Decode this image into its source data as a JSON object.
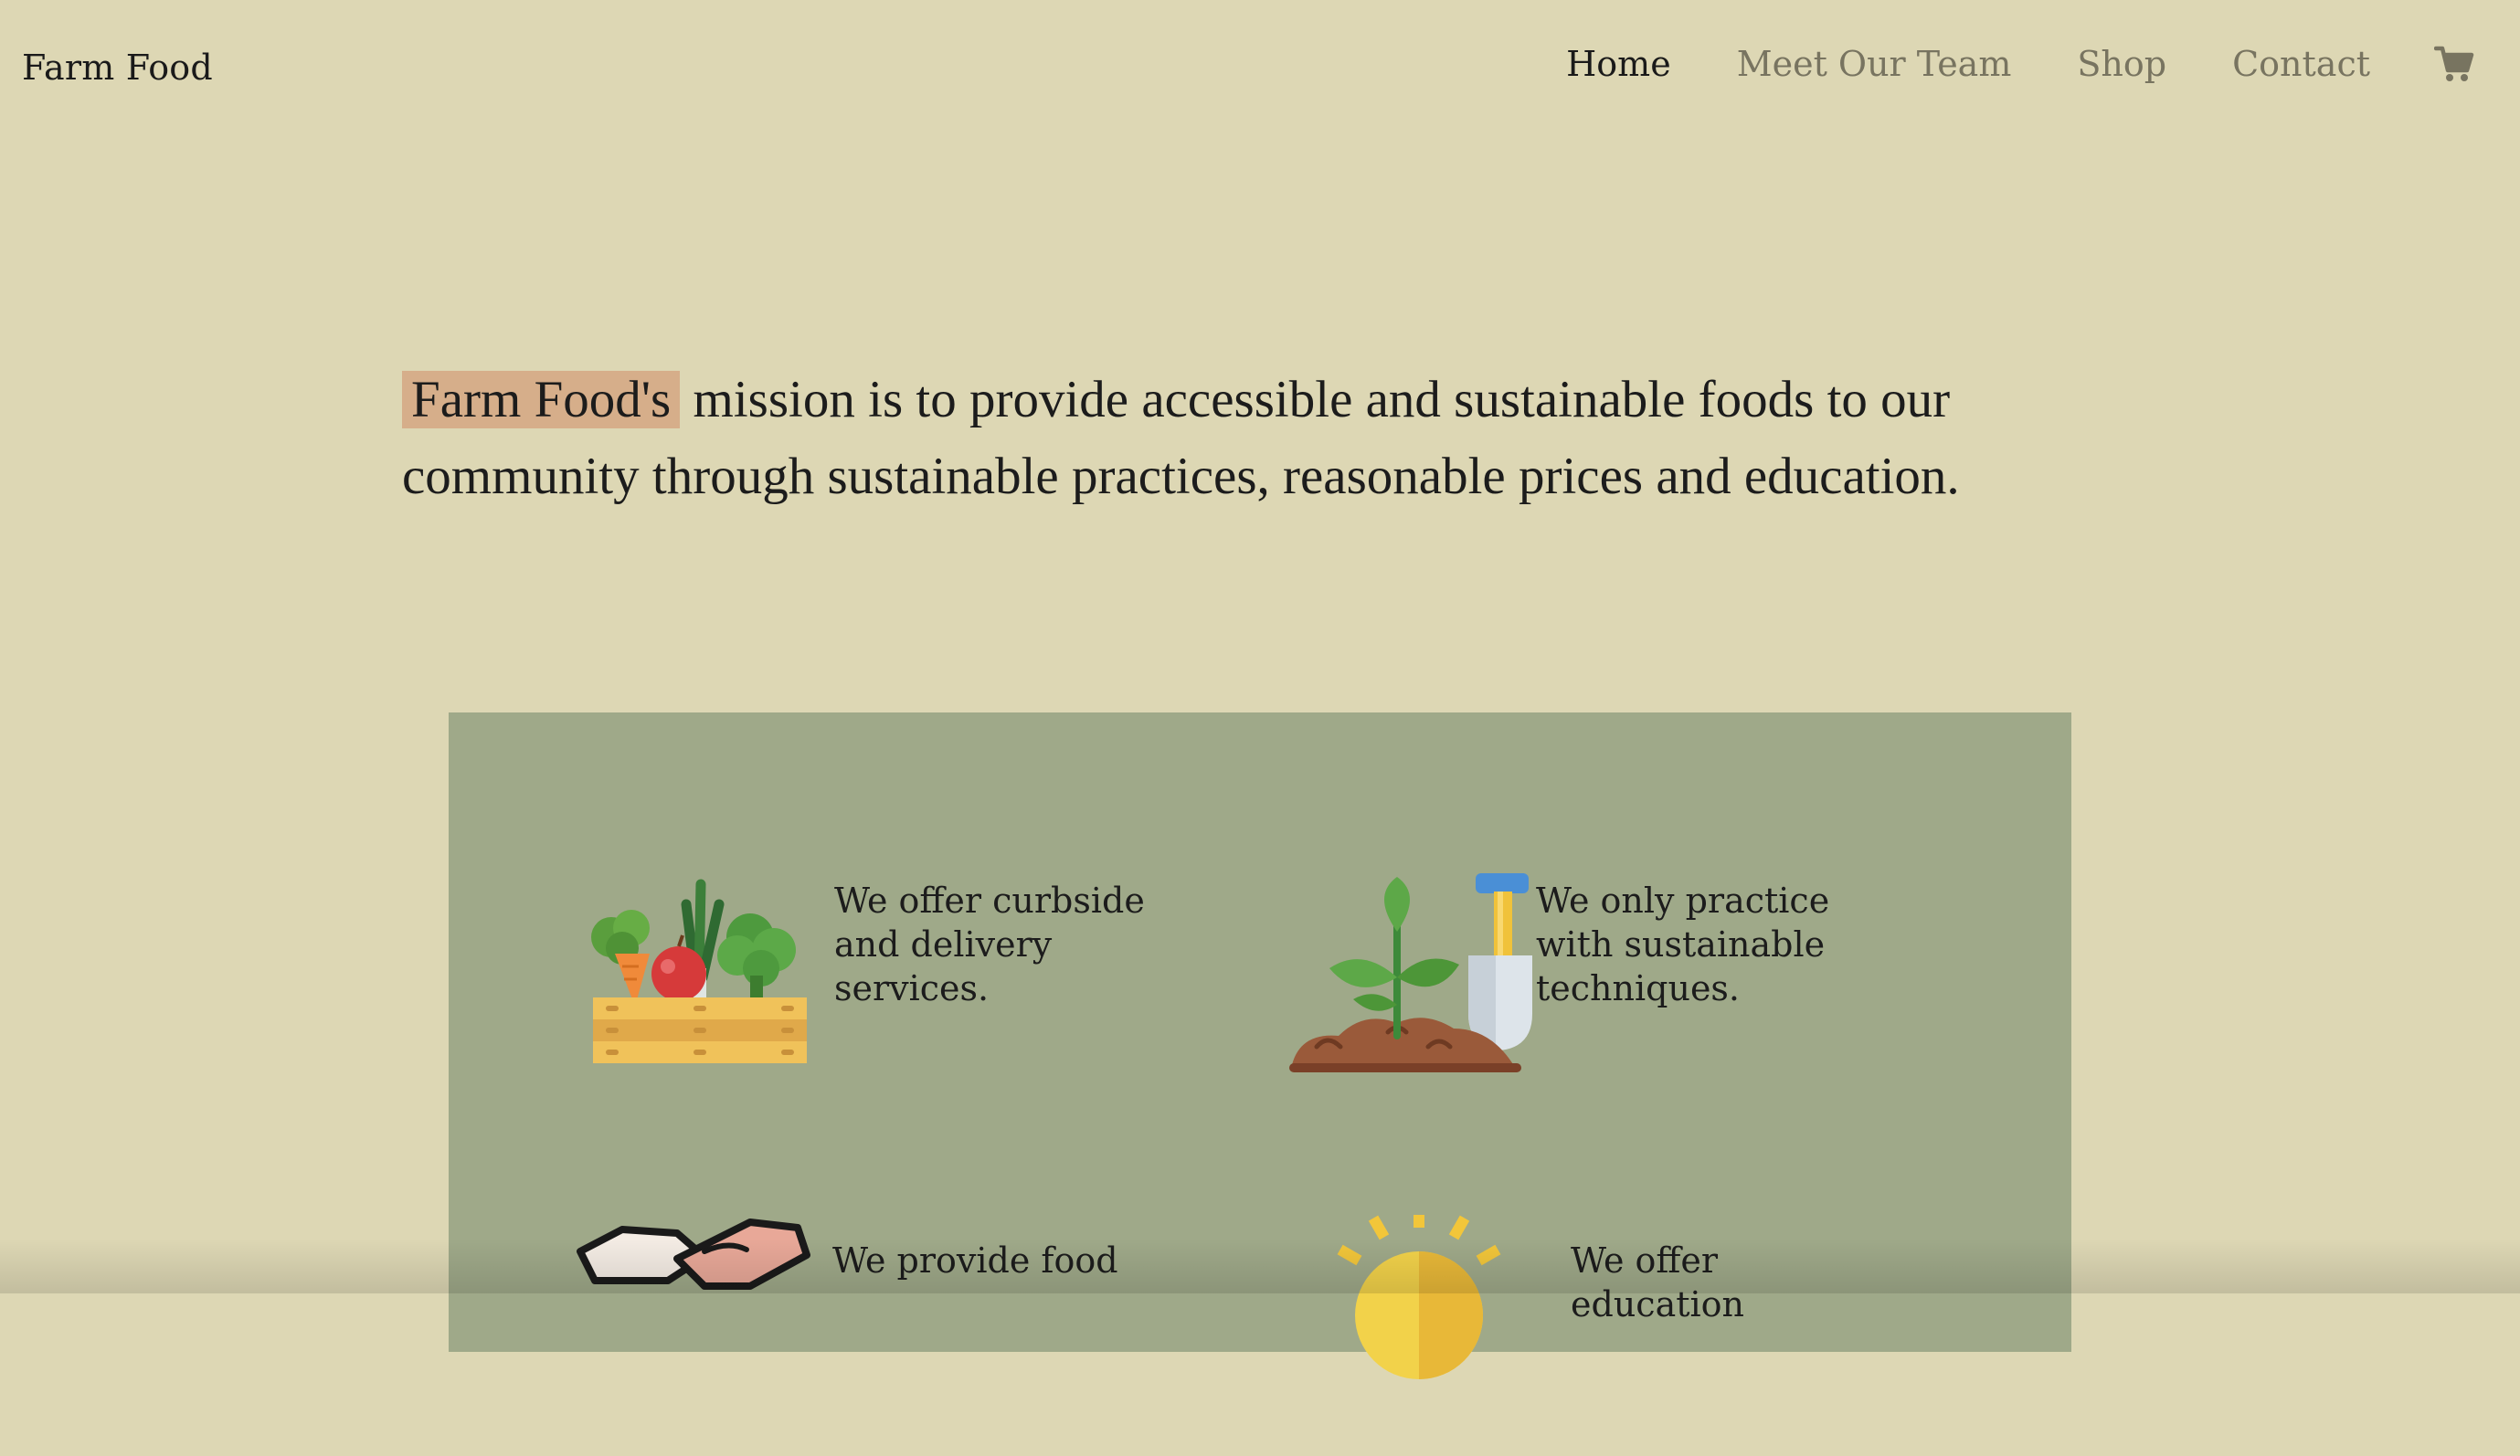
{
  "brand": "Farm Food",
  "nav": {
    "items": [
      {
        "label": "Home",
        "active": true
      },
      {
        "label": "Meet Our Team",
        "active": false
      },
      {
        "label": "Shop",
        "active": false
      },
      {
        "label": "Contact",
        "active": false
      }
    ],
    "cart_icon": "shopping-cart-icon"
  },
  "mission": {
    "highlight": "Farm Food's",
    "text": " mission is to provide accessible and sustainable foods to our community through sustainable practices, reasonable prices and education."
  },
  "features": [
    {
      "icon": "vegetable-crate-icon",
      "text": "We offer curbside and delivery services."
    },
    {
      "icon": "plant-shovel-icon",
      "text": "We only practice with sustainable techniques."
    },
    {
      "icon": "handshake-icon",
      "text": "We provide food"
    },
    {
      "icon": "sun-icon",
      "text": "We offer education"
    }
  ],
  "colors": {
    "page_bg": "#ddd7b4",
    "panel_bg": "#9fa989",
    "highlight": "#d6ae8a",
    "nav_inactive": "#787460"
  }
}
